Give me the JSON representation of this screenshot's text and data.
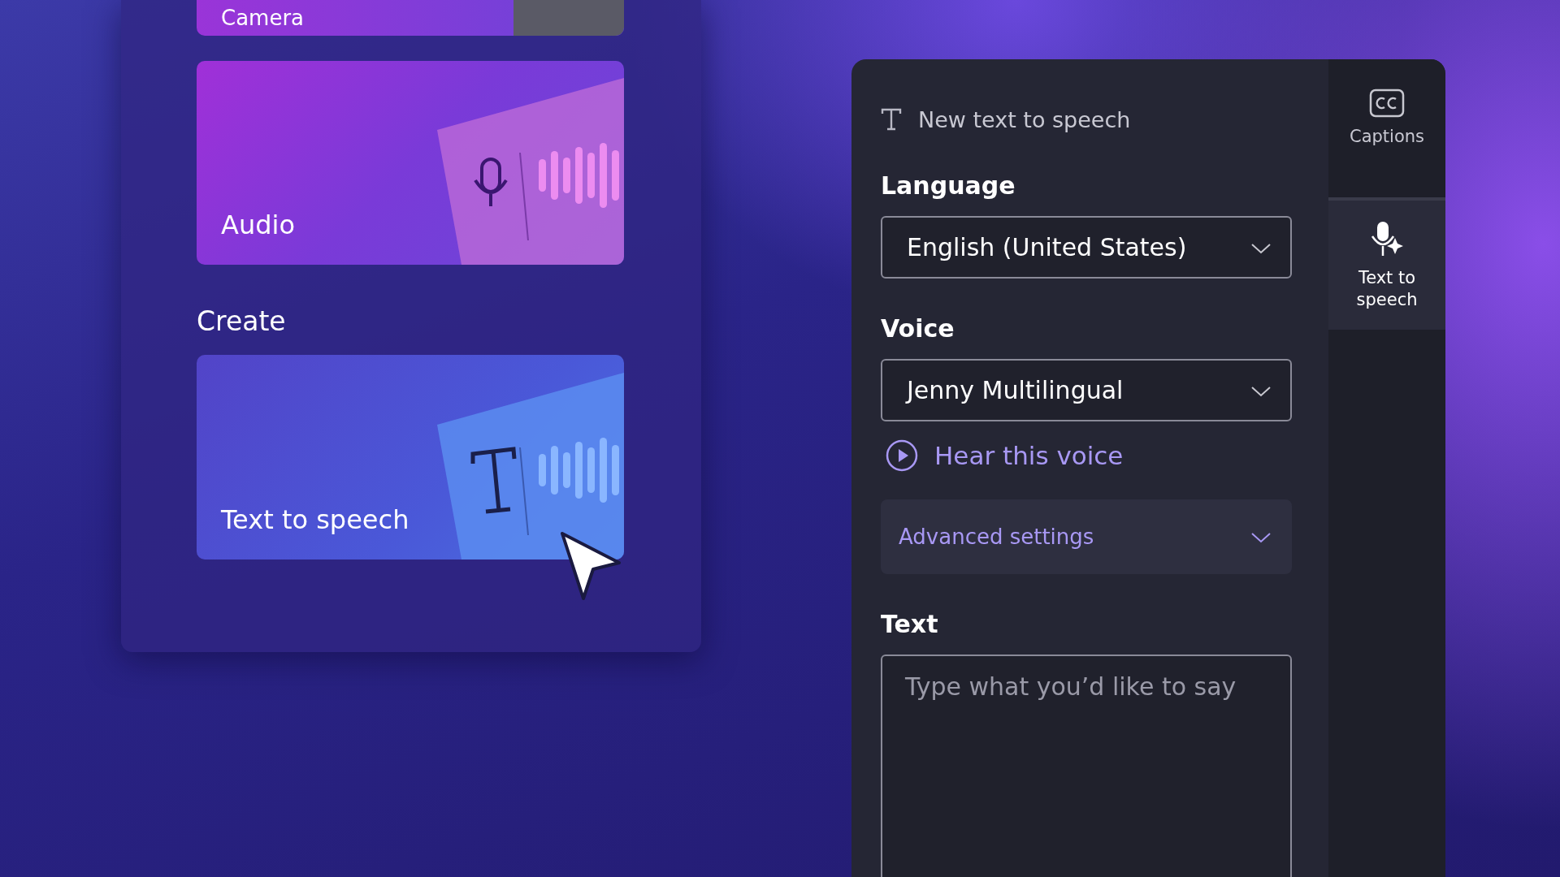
{
  "library": {
    "cards": [
      {
        "kind": "camera",
        "label": "Camera"
      },
      {
        "kind": "audio",
        "label": "Audio"
      }
    ],
    "create_heading": "Create",
    "create_cards": [
      {
        "kind": "tts",
        "label": "Text to speech"
      }
    ]
  },
  "panel": {
    "title": "New text to speech",
    "fields": [
      {
        "label": "Language",
        "value": "English (United States)"
      },
      {
        "label": "Voice",
        "value": "Jenny Multilingual"
      }
    ],
    "preview_link": "Hear this voice",
    "advanced": {
      "label": "Advanced settings",
      "expanded": false
    },
    "text_label": "Text",
    "text_placeholder": "Type what you’d like to say"
  },
  "sidebar": [
    {
      "kind": "captions",
      "label": "Captions",
      "selected": false
    },
    {
      "kind": "tts",
      "label": "Text to speech",
      "selected": true
    }
  ]
}
